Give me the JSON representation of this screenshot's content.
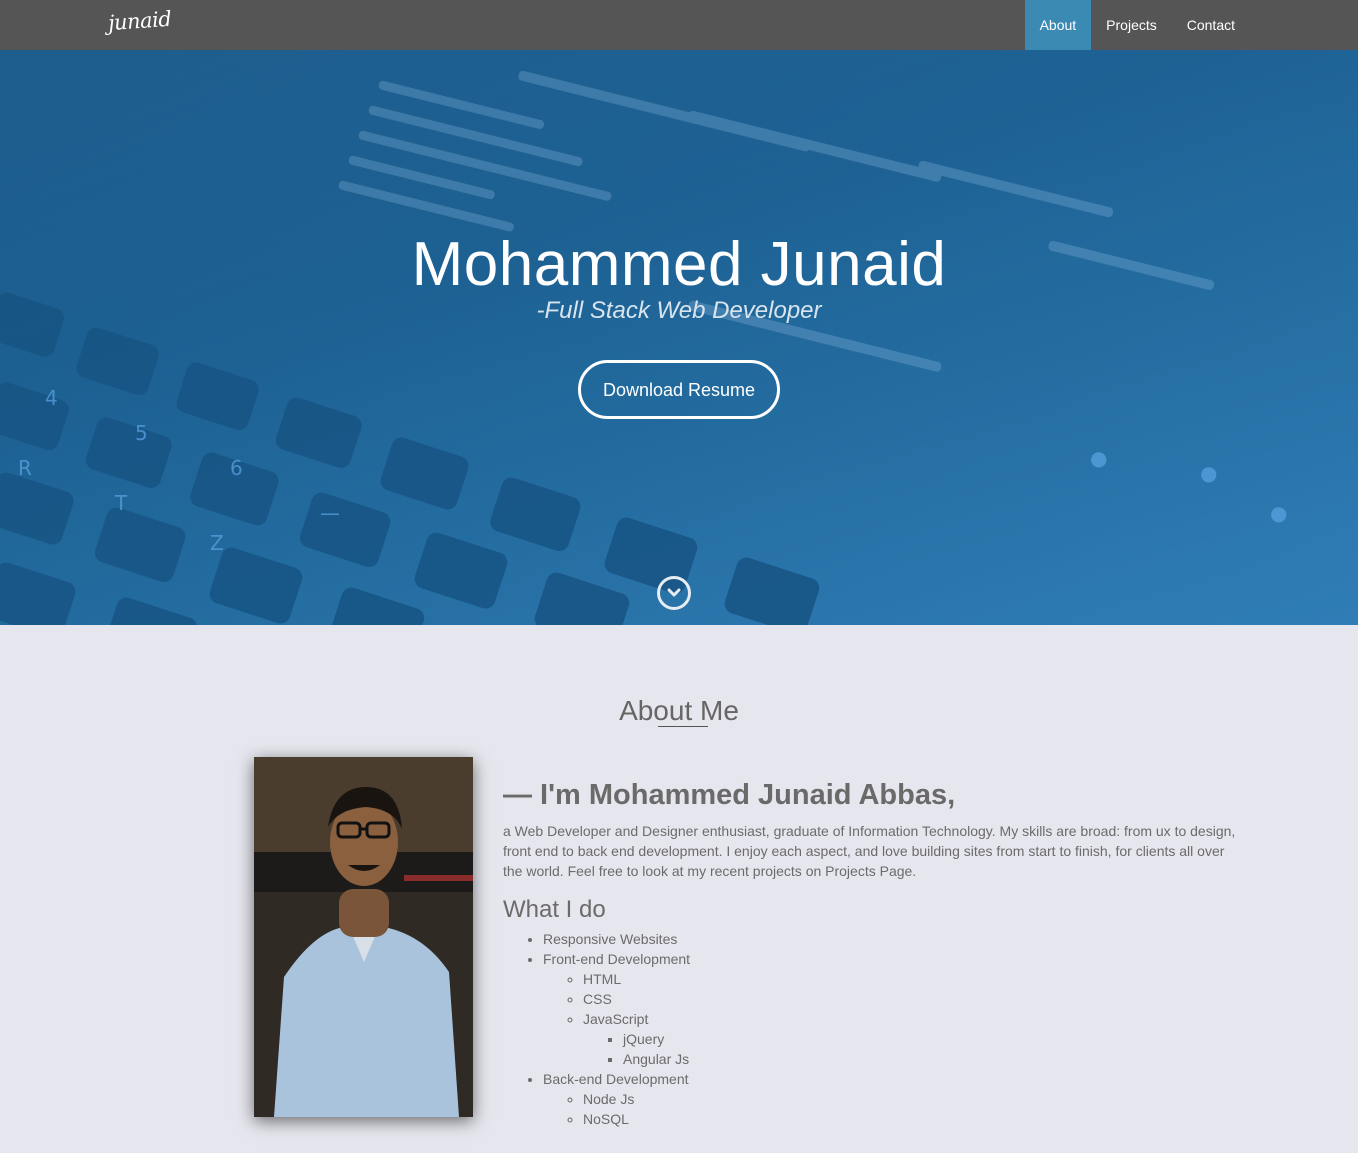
{
  "navbar": {
    "brand": "junaid",
    "items": [
      {
        "label": "About",
        "active": true
      },
      {
        "label": "Projects",
        "active": false
      },
      {
        "label": "Contact",
        "active": false
      }
    ],
    "active_color": "#3b8ab3",
    "background": "#555555"
  },
  "hero": {
    "title": "Mohammed Junaid",
    "subtitle": "-Full Stack Web Developer",
    "button_label": "Download Resume",
    "scroll_icon": "chevron-down-icon"
  },
  "about": {
    "heading": "About Me",
    "intro": "— I'm Mohammed Junaid Abbas,",
    "description": "a Web Developer and Designer enthusiast, graduate of Information Technology. My skills are broad: from ux to design, front end to back end development. I enjoy each aspect, and love building sites from start to finish, for clients all over the world. Feel free to look at my recent projects on Projects Page.",
    "what_heading": "What I do",
    "skills": {
      "responsive": "Responsive Websites",
      "frontend": "Front-end Development",
      "html": "HTML",
      "css": "CSS",
      "javascript": "JavaScript",
      "jquery": "jQuery",
      "angular": "Angular Js",
      "backend": "Back-end Development",
      "node": "Node Js",
      "nosql": "NoSQL"
    }
  }
}
